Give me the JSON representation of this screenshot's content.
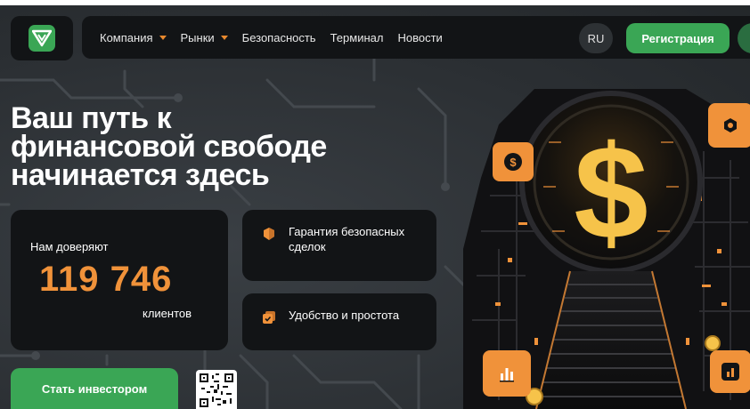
{
  "header": {
    "nav": [
      {
        "label": "Компания",
        "has_dropdown": true
      },
      {
        "label": "Рынки",
        "has_dropdown": true
      },
      {
        "label": "Безопасность",
        "has_dropdown": false
      },
      {
        "label": "Терминал",
        "has_dropdown": false
      },
      {
        "label": "Новости",
        "has_dropdown": false
      }
    ],
    "language": "RU",
    "register_label": "Регистрация"
  },
  "hero": {
    "title_lines": [
      "Ваш путь к",
      "финансовой свободе",
      "начинается здесь"
    ],
    "trust": {
      "label": "Нам доверяют",
      "number": "119 746",
      "unit": "клиентов"
    },
    "features": [
      {
        "text": "Гарантия безопасных сделок",
        "icon": "shield-icon"
      },
      {
        "text": "Удобство и простота",
        "icon": "check-badge-icon"
      }
    ],
    "cta_label": "Стать инвестором"
  },
  "icons": {
    "logo": "logo-icon",
    "dollar": "dollar-icon",
    "hexagon": "hexagon-icon",
    "chart": "bar-chart-icon"
  },
  "colors": {
    "accent_green": "#3aa655",
    "accent_orange": "#f0923a",
    "card_bg": "#121416"
  }
}
